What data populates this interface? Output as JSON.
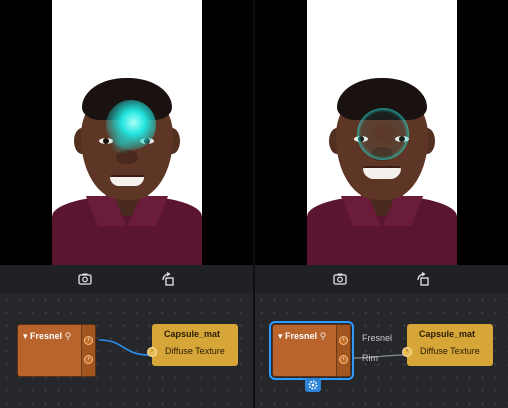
{
  "panels": [
    {
      "id": "left",
      "nodes": {
        "fresnel": {
          "title": "Fresnel",
          "selected": false
        },
        "material": {
          "title": "Capsule_mat",
          "input_label": "Diffuse Texture"
        }
      },
      "output_labels": []
    },
    {
      "id": "right",
      "nodes": {
        "fresnel": {
          "title": "Fresnel",
          "selected": true
        },
        "material": {
          "title": "Capsule_mat",
          "input_label": "Diffuse Texture"
        }
      },
      "output_labels": [
        "Fresnel",
        "Rim"
      ]
    }
  ],
  "colors": {
    "node_orange": "#b8642c",
    "node_yellow": "#d7a638",
    "selection_blue": "#2d9bff",
    "glow_cyan": "#22e6e0",
    "connection_blue": "#2a8ff0",
    "connection_grey": "#8a8d92"
  },
  "icons": {
    "camera_flip": "camera-flip-icon",
    "rotate": "rotate-icon",
    "fresnel_caret": "caret-down-icon",
    "fresnel_link": "link-icon",
    "settings": "gear-icon"
  }
}
